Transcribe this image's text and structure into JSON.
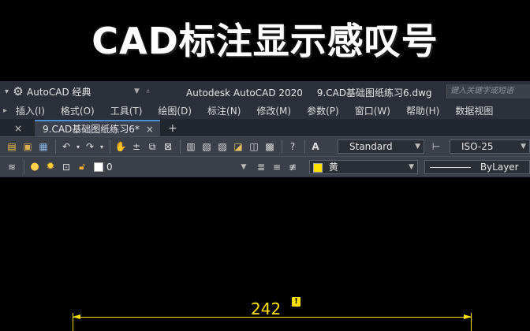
{
  "banner": {
    "title": "CAD标注显示感叹号"
  },
  "titlebar": {
    "workspace": "AutoCAD 经典",
    "app_name": "Autodesk AutoCAD 2020",
    "file_name": "9.CAD基础图纸练习6.dwg",
    "search_placeholder": "键入关键字或短语"
  },
  "menubar": {
    "items": [
      "插入(I)",
      "格式(O)",
      "工具(T)",
      "绘图(D)",
      "标注(N)",
      "修改(M)",
      "参数(P)",
      "窗口(W)",
      "帮助(H)",
      "数据视图"
    ]
  },
  "tabs": {
    "active": "9.CAD基础图纸练习6*",
    "close_glyph": "×",
    "new_glyph": "+"
  },
  "toolbar": {
    "text_style": "Standard",
    "dim_style": "ISO-25"
  },
  "layer_toolbar": {
    "layer_name": "0",
    "color_name": "黄",
    "color_hex": "#ffe100",
    "linetype": "ByLayer"
  },
  "drawing": {
    "dimension_value": "242",
    "warning_glyph": "!",
    "dimension_color": "#ffe100"
  }
}
